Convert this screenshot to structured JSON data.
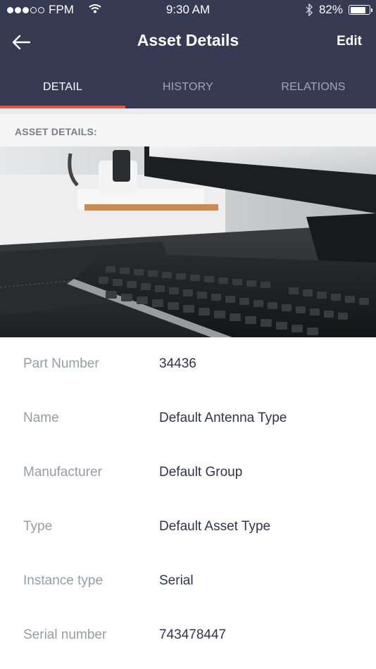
{
  "status_bar": {
    "carrier": "FPM",
    "time": "9:30 AM",
    "battery": "82%",
    "battery_level": 0.82
  },
  "nav": {
    "title": "Asset Details",
    "edit_label": "Edit"
  },
  "tabs": [
    {
      "label": "DETAIL",
      "active": true
    },
    {
      "label": "HISTORY",
      "active": false
    },
    {
      "label": "RELATIONS",
      "active": false
    }
  ],
  "section": {
    "label": "ASSET DETAILS:"
  },
  "details": [
    {
      "label": "Part Number",
      "value": "34436"
    },
    {
      "label": "Name",
      "value": "Default Antenna Type"
    },
    {
      "label": "Manufacturer",
      "value": "Default Group"
    },
    {
      "label": "Type",
      "value": "Default Asset Type"
    },
    {
      "label": "Instance type",
      "value": "Serial"
    },
    {
      "label": "Serial number",
      "value": "743478447"
    }
  ],
  "colors": {
    "header_bg": "#363a52",
    "active_tab_indicator": "#e8504a",
    "label_text": "#9a9ca4",
    "value_text": "#31344a"
  }
}
